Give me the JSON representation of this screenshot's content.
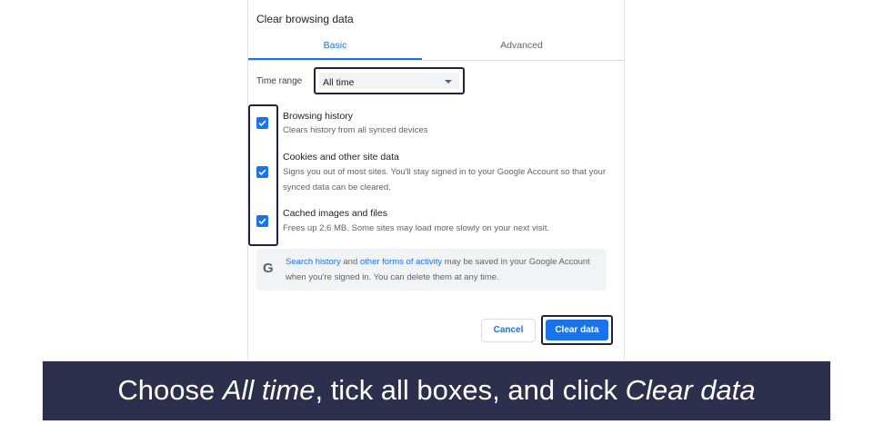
{
  "dialog": {
    "title": "Clear browsing data",
    "tabs": [
      {
        "label": "Basic",
        "active": true
      },
      {
        "label": "Advanced",
        "active": false
      }
    ],
    "time_range": {
      "label": "Time range",
      "selected": "All time"
    },
    "items": [
      {
        "title": "Browsing history",
        "description": "Clears history from all synced devices",
        "checked": true
      },
      {
        "title": "Cookies and other site data",
        "description": "Signs you out of most sites. You'll stay signed in to your Google Account so that your synced data can be cleared.",
        "checked": true
      },
      {
        "title": "Cached images and files",
        "description": "Frees up 2.6 MB. Some sites may load more slowly on your next visit.",
        "checked": true
      }
    ],
    "info": {
      "icon": "google-g-icon",
      "link1": "Search history",
      "text1": " and ",
      "link2": "other forms of activity",
      "text2": " may be saved in your Google Account when you're signed in. You can delete them at any time."
    },
    "buttons": {
      "cancel": "Cancel",
      "clear": "Clear data"
    }
  },
  "caption": {
    "part1": "Choose ",
    "em1": "All time",
    "part2": ", tick all boxes, and click ",
    "em2": "Clear data"
  },
  "colors": {
    "accent": "#1a73e8",
    "highlight_outline": "#1f2340",
    "caption_background": "#2d2f4c"
  }
}
